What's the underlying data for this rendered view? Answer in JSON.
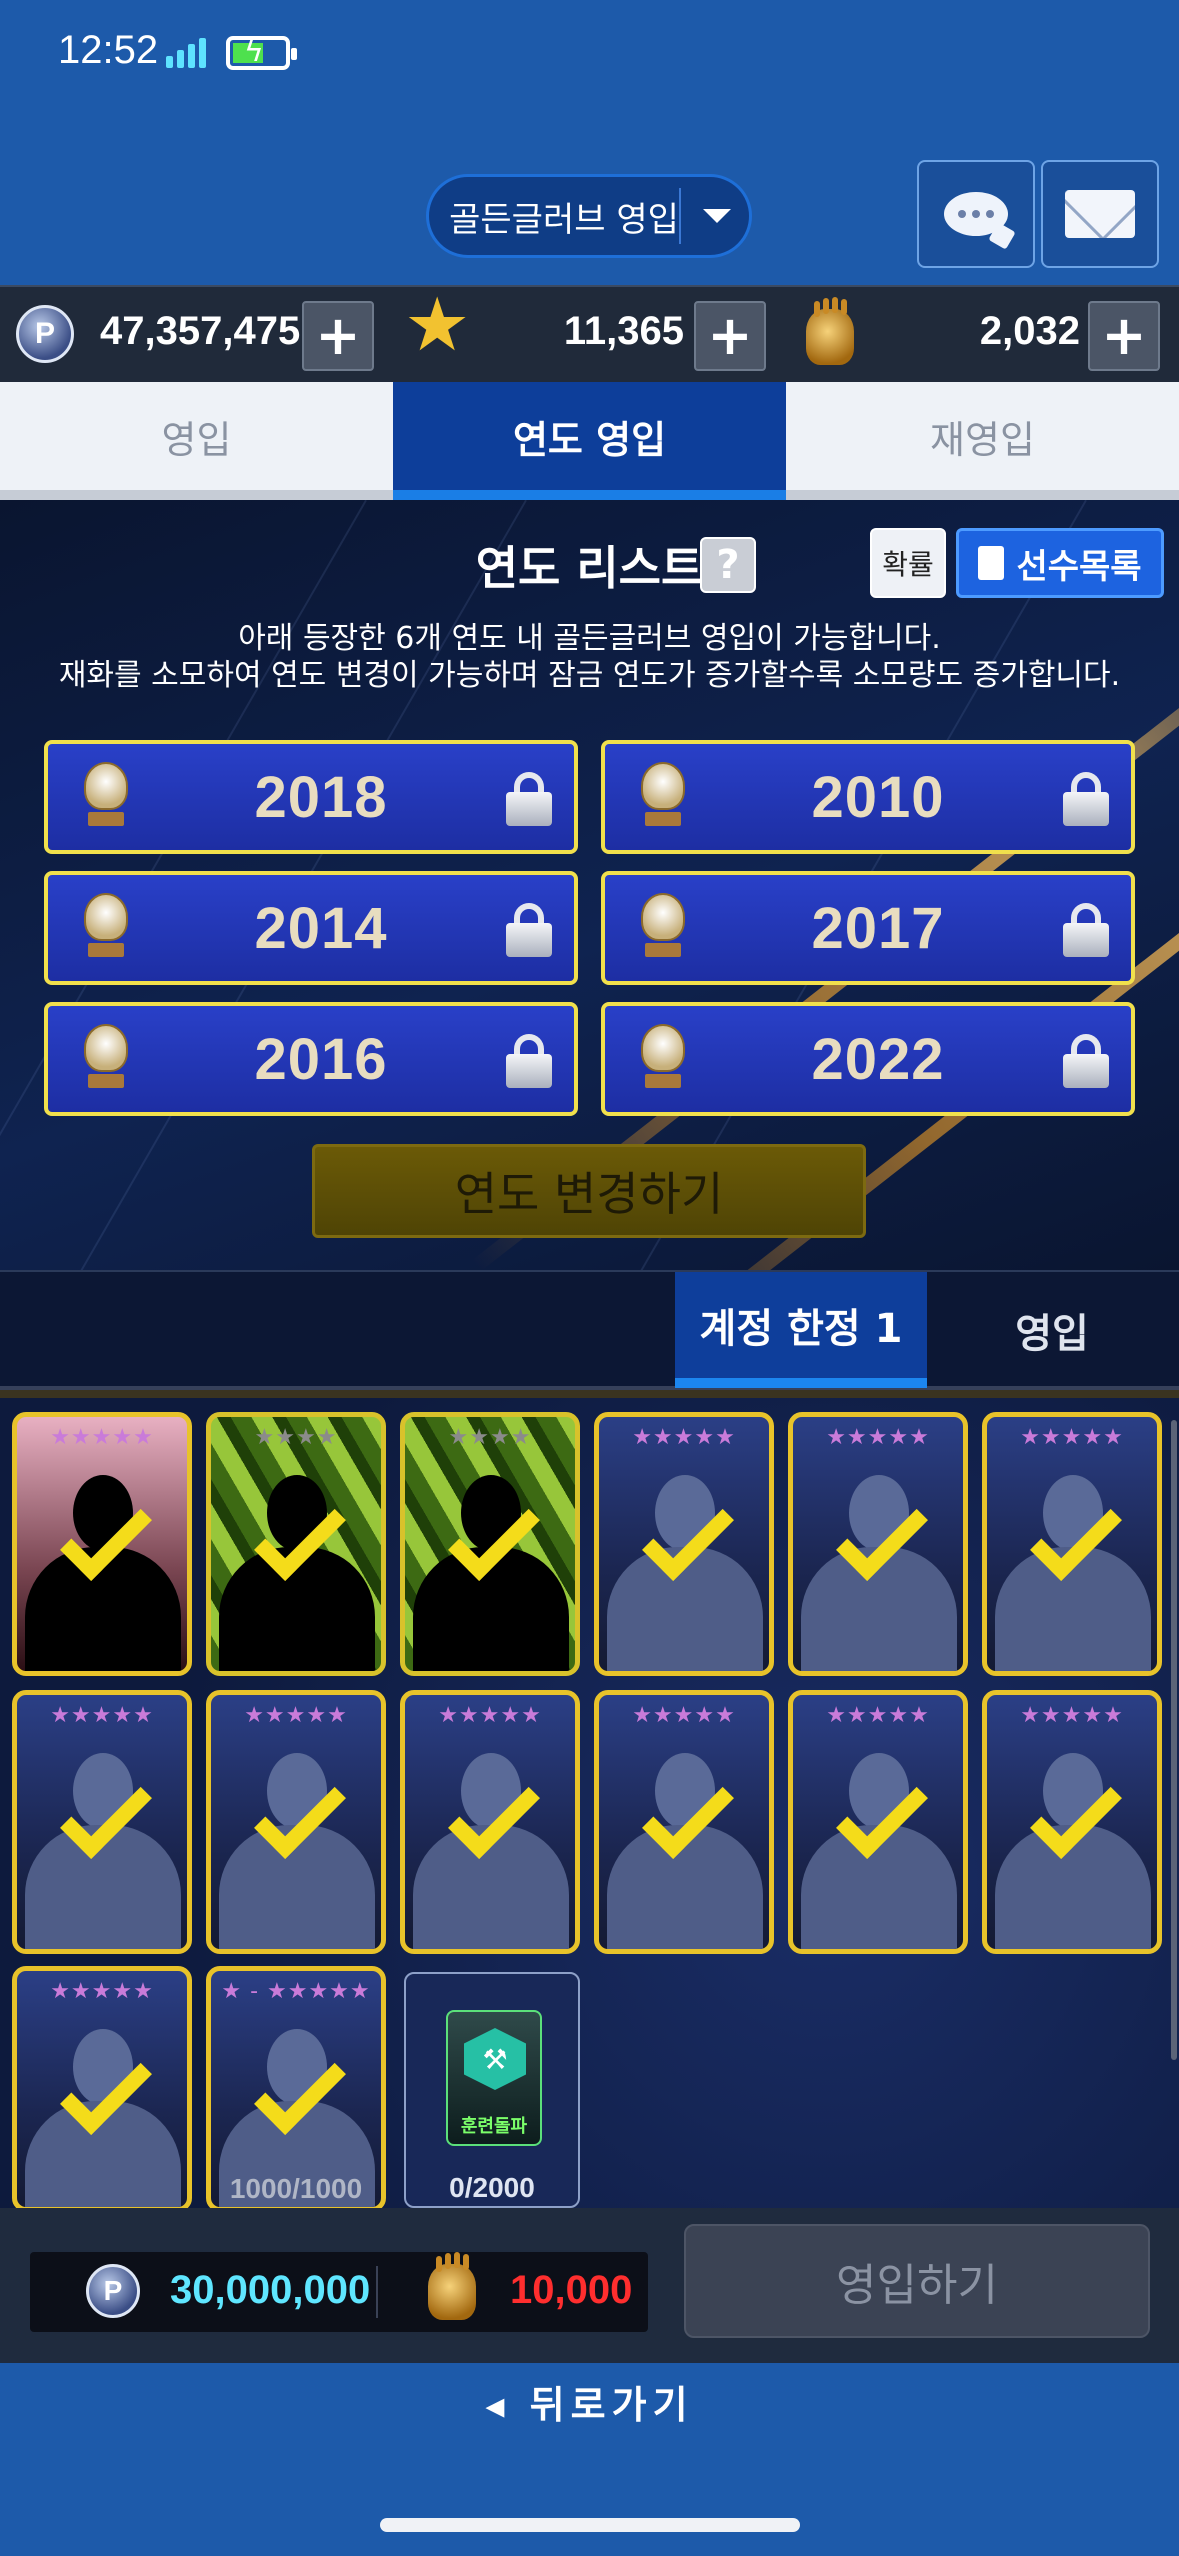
{
  "status_bar": {
    "time": "12:52"
  },
  "header": {
    "mode_select": "골든글러브 영입"
  },
  "currency": {
    "points": "47,357,475",
    "stars": "11,365",
    "gloves": "2,032",
    "plus": "+"
  },
  "tabs": [
    {
      "label": "영입",
      "active": false
    },
    {
      "label": "연도 영입",
      "active": true
    },
    {
      "label": "재영입",
      "active": false
    }
  ],
  "year_panel": {
    "title": "연도 리스트",
    "help": "?",
    "probability_button": "확률",
    "roster_button": "선수목록",
    "description_line1": "아래 등장한 6개 연도 내 골든글러브 영입이 가능합니다.",
    "description_line2": "재화를 소모하여 연도 변경이 가능하며 잠금 연도가 증가할수록 소모량도 증가합니다.",
    "years": [
      "2018",
      "2010",
      "2014",
      "2017",
      "2016",
      "2022"
    ],
    "change_button": "연도 변경하기"
  },
  "subtabs": [
    {
      "label": "계정 한정 1",
      "active": true
    },
    {
      "label": "영입",
      "active": false
    }
  ],
  "cards": {
    "star_rows": [
      "★★★★★",
      "★★★★",
      "★★★★"
    ],
    "card8_stars": "★ - ★★★★★",
    "card8_count": "1000/1000",
    "item_label": "훈련돌파",
    "item_count": "0/2000"
  },
  "cost": {
    "points": "30,000,000",
    "gloves": "10,000"
  },
  "recruit_button": "영입하기",
  "back_button": "◂ 뒤로가기",
  "colors": {
    "header_blue": "#1d5aaa",
    "active_tab": "#0d3e9a",
    "year_button": "#2940c8",
    "gold_border": "#f1e04c",
    "cost_points": "#5fe6ff",
    "cost_gloves": "#ff2e2e"
  }
}
